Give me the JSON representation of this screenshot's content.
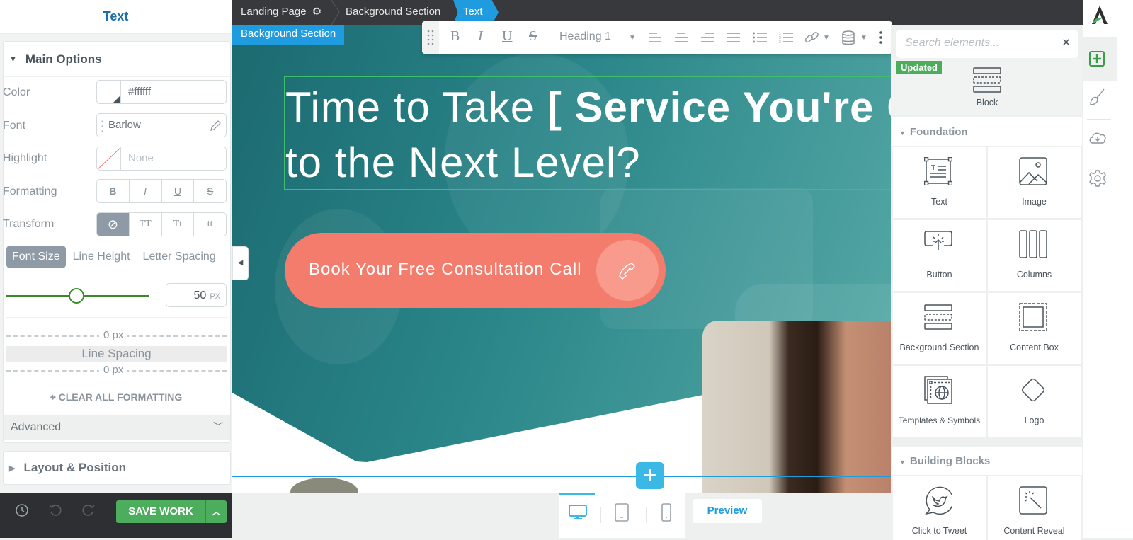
{
  "left_panel": {
    "title": "Text",
    "main_options": {
      "header": "Main Options",
      "color": {
        "label": "Color",
        "value": "#ffffff"
      },
      "font": {
        "label": "Font",
        "value": "Barlow"
      },
      "highlight": {
        "label": "Highlight",
        "value": "None"
      },
      "formatting": {
        "label": "Formatting",
        "buttons": [
          "B",
          "I",
          "U",
          "S"
        ]
      },
      "transform": {
        "label": "Transform",
        "buttons": [
          "⊘",
          "TT",
          "Tt",
          "tt"
        ],
        "active_index": 0
      },
      "size_tabs": [
        "Font Size",
        "Line Height",
        "Letter Spacing"
      ],
      "active_size_tab": "Font Size",
      "font_size": {
        "value": "50",
        "unit": "PX",
        "slider_fraction": 0.5
      },
      "line_spacing": {
        "label": "Line Spacing",
        "top": "0 px",
        "bottom": "0 px"
      },
      "clear_formatting": "CLEAR ALL FORMATTING",
      "advanced": "Advanced"
    },
    "layout_position": "Layout & Position",
    "save_label": "SAVE WORK"
  },
  "breadcrumb": {
    "items": [
      "Landing Page",
      "Background Section",
      "Text"
    ],
    "active": "Text"
  },
  "canvas": {
    "section_tag": "Background Section",
    "heading_line1_light": "Time to Take ",
    "heading_line1_bold": "[ Service You're Offe",
    "heading_line2": "to the Next Level?",
    "cta_label": "Book Your Free Consultation Call",
    "insert_label": "+"
  },
  "text_toolbar": {
    "bold": "B",
    "italic": "I",
    "underline": "U",
    "strike": "S",
    "heading_select": "Heading 1"
  },
  "device_bar": {
    "devices": [
      "desktop",
      "tablet",
      "mobile"
    ],
    "active_device": "desktop",
    "preview_label": "Preview"
  },
  "right_panel": {
    "search_placeholder": "Search elements...",
    "badge": "Updated",
    "block_label": "Block",
    "foundation": {
      "header": "Foundation",
      "items": [
        "Text",
        "Image",
        "Button",
        "Columns",
        "Background Section",
        "Content Box",
        "Templates & Symbols",
        "Logo"
      ]
    },
    "building_blocks": {
      "header": "Building Blocks",
      "items": [
        "Click to Tweet",
        "Content Reveal"
      ]
    }
  },
  "colors": {
    "accent_blue": "#1f9be0",
    "save_green": "#4cae5c",
    "cta_coral": "#f47c6d",
    "hero_teal": "#2a8689"
  }
}
